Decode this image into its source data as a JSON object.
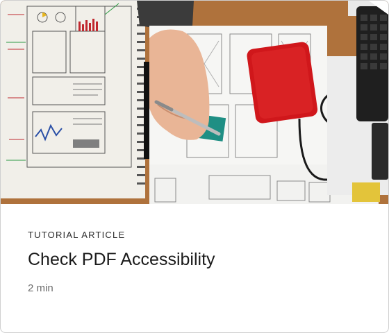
{
  "card": {
    "kind_label": "TUTORIAL ARTICLE",
    "title": "Check PDF Accessibility",
    "duration": "2 min",
    "image_alt": ""
  },
  "colors": {
    "title": "#1b1b1b",
    "meta": "#6b6b6b",
    "border": "#cfcfcf",
    "hard_drive": "#d0171b"
  }
}
